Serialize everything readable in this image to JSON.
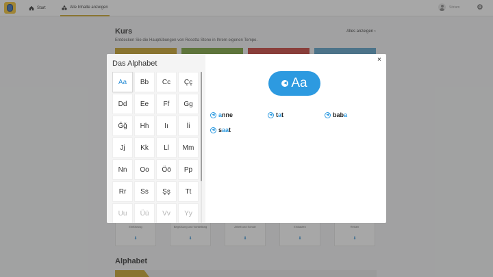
{
  "nav": {
    "start_label": "Start",
    "all_label": "Alle Inhalte anzeigen",
    "user_label": "Sitriam"
  },
  "background": {
    "title": "Kurs",
    "subtitle": "Entdecken Sie die Hauptübungen von Rosetta Stone in Ihrem eigenen Tempo.",
    "show_all": "Alles anzeigen",
    "bottom_cards": [
      "Einführung",
      "Begrüßung und Vorstellung",
      "Arbeit und Schule",
      "Einkaufen",
      "Reisen"
    ],
    "alphabet_title": "Alphabet",
    "tab_colors": [
      "#c9a227",
      "#7aa33b",
      "#c9403a",
      "#5aa0c8"
    ]
  },
  "modal": {
    "title": "Das Alphabet",
    "selected_letter": "Aa",
    "letters": [
      "Aa",
      "Bb",
      "Cc",
      "Çç",
      "Dd",
      "Ee",
      "Ff",
      "Gg",
      "Ğğ",
      "Hh",
      "Iı",
      "İi",
      "Jj",
      "Kk",
      "Ll",
      "Mm",
      "Nn",
      "Oo",
      "Öö",
      "Pp",
      "Rr",
      "Ss",
      "Şş",
      "Tt",
      "Uu",
      "Üü",
      "Vv",
      "Yy"
    ],
    "close_label": "×",
    "words": [
      {
        "pre": "",
        "hl": "a",
        "post": "nne"
      },
      {
        "pre": "t",
        "hl": "a",
        "post": "t"
      },
      {
        "pre": "bab",
        "hl": "a",
        "post": ""
      },
      {
        "pre": "s",
        "hl": "aa",
        "post": "t"
      }
    ],
    "accent_color": "#2d9ae0"
  }
}
